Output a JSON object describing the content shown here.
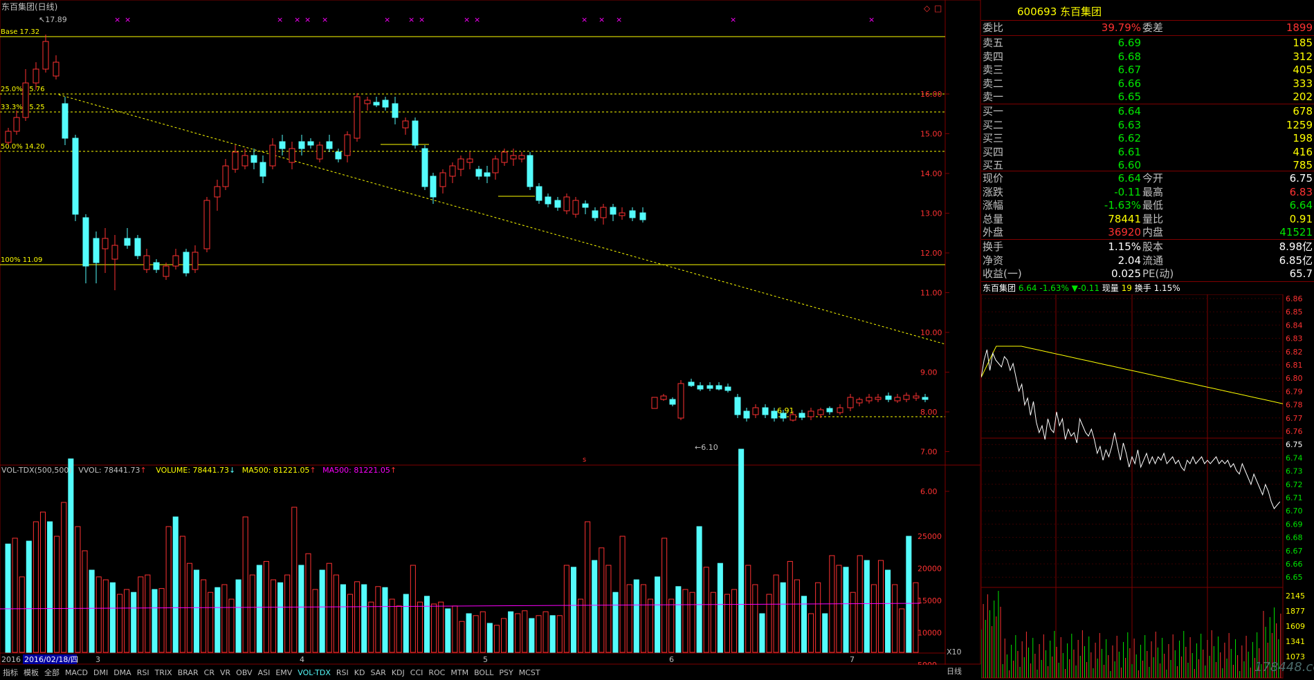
{
  "chart_title": "东百集团(日线)",
  "ticker": {
    "code": "600693",
    "name": "东百集团"
  },
  "indicator_header": {
    "name": "VOL-TDX(500,500)",
    "vvol_label": "VVOL: 78441.73",
    "volume_label": "VOLUME: 78441.73",
    "ma1_label": "MA500: 81221.05",
    "ma2_label": "MA500: 81221.05"
  },
  "fib_labels": {
    "base": "Base 17.32",
    "f25": "25.0% 15.76",
    "f33": "33.3% 15.25",
    "f50": "50.0% 14.20",
    "f100": "100% 11.09"
  },
  "annotations": {
    "high": "17.89",
    "low1": "6.10",
    "mark": "6.91"
  },
  "date_marker": "2016/02/18/四",
  "year_label": "2016",
  "x10_label": "X10",
  "period_label": "日线",
  "bottom_tabs": [
    "指标",
    "模板",
    "全部",
    "MACD",
    "DMI",
    "DMA",
    "RSI",
    "TRIX",
    "BRAR",
    "CR",
    "VR",
    "OBV",
    "ASI",
    "EMV",
    "VOL-TDX",
    "RSI",
    "KD",
    "SAR",
    "KDJ",
    "CCI",
    "ROC",
    "MTM",
    "BOLL",
    "PSY",
    "MCST"
  ],
  "month_labels": [
    "3",
    "4",
    "5",
    "6",
    "7"
  ],
  "price_axis": [
    "16.00",
    "15.00",
    "14.00",
    "13.00",
    "12.00",
    "11.00",
    "10.00",
    "9.00",
    "8.00",
    "7.00",
    "6.00"
  ],
  "volume_axis": [
    "25000",
    "20000",
    "15000",
    "10000",
    "5000"
  ],
  "quote": {
    "webi": {
      "label": "委比",
      "pct": "39.79%",
      "diff_label": "委差",
      "diff": "1899"
    },
    "asks": [
      {
        "label": "卖五",
        "price": "6.69",
        "vol": "185"
      },
      {
        "label": "卖四",
        "price": "6.68",
        "vol": "312"
      },
      {
        "label": "卖三",
        "price": "6.67",
        "vol": "405"
      },
      {
        "label": "卖二",
        "price": "6.66",
        "vol": "333"
      },
      {
        "label": "卖一",
        "price": "6.65",
        "vol": "202"
      }
    ],
    "bids": [
      {
        "label": "买一",
        "price": "6.64",
        "vol": "678"
      },
      {
        "label": "买二",
        "price": "6.63",
        "vol": "1259"
      },
      {
        "label": "买三",
        "price": "6.62",
        "vol": "198"
      },
      {
        "label": "买四",
        "price": "6.61",
        "vol": "416"
      },
      {
        "label": "买五",
        "price": "6.60",
        "vol": "785"
      }
    ],
    "stats1": [
      {
        "l1": "现价",
        "v1": "6.64",
        "l2": "今开",
        "v2": "6.75"
      },
      {
        "l1": "涨跌",
        "v1": "-0.11",
        "l2": "最高",
        "v2": "6.83"
      },
      {
        "l1": "涨幅",
        "v1": "-1.63%",
        "l2": "最低",
        "v2": "6.64"
      },
      {
        "l1": "总量",
        "v1": "78441",
        "l2": "量比",
        "v2": "0.91"
      },
      {
        "l1": "外盘",
        "v1": "36920",
        "l2": "内盘",
        "v2": "41521"
      }
    ],
    "stats2": [
      {
        "l1": "换手",
        "v1": "1.15%",
        "l2": "股本",
        "v2": "8.98亿"
      },
      {
        "l1": "净资",
        "v1": "2.04",
        "l2": "流通",
        "v2": "6.85亿"
      },
      {
        "l1": "收益(一)",
        "v1": "0.025",
        "l2": "PE(动)",
        "v2": "65.7"
      }
    ]
  },
  "intraday": {
    "name": "东百集团",
    "price": "6.64",
    "pct": "-1.63%",
    "change": "▼-0.11",
    "vol_label": "现量",
    "vol": "19",
    "turnover_label": "换手",
    "turnover": "1.15%",
    "axis": [
      "6.86",
      "6.85",
      "6.84",
      "6.83",
      "6.82",
      "6.81",
      "6.80",
      "6.79",
      "6.78",
      "6.77",
      "6.76",
      "6.75",
      "6.74",
      "6.73",
      "6.72",
      "6.71",
      "6.70",
      "6.69",
      "6.68",
      "6.67",
      "6.66",
      "6.65",
      "2145",
      "1877",
      "1609",
      "1341",
      "1073"
    ]
  },
  "colors": {
    "up": "#ff3232",
    "down": "#54fcfc",
    "fib": "#ffff00",
    "ma": "#ff00ff",
    "frame": "#800000"
  }
}
